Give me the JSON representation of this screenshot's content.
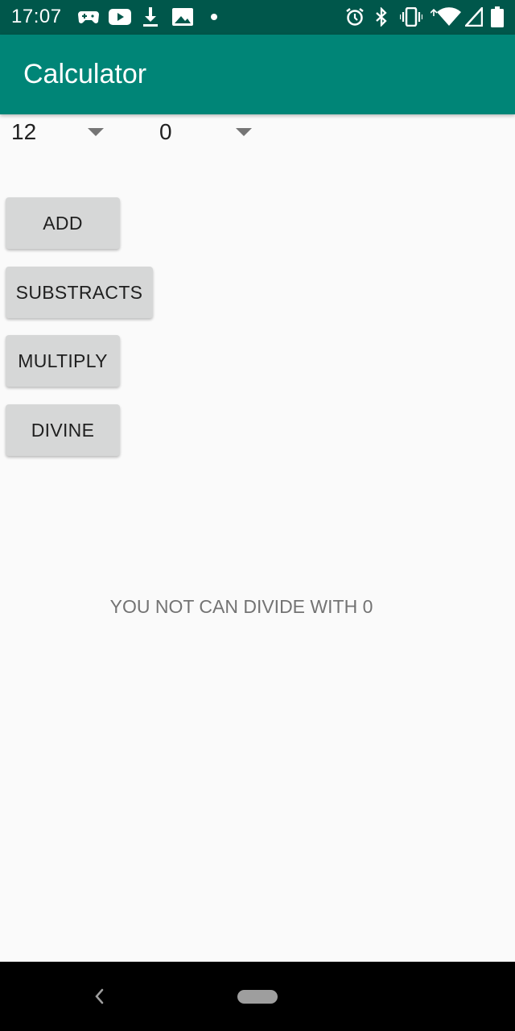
{
  "status_bar": {
    "time": "17:07",
    "left_icons": [
      "gamepad-icon",
      "youtube-icon",
      "download-icon",
      "image-icon",
      "dot-icon"
    ],
    "right_icons": [
      "alarm-icon",
      "bluetooth-icon",
      "vibrate-icon",
      "wifi-icon",
      "signal-icon",
      "battery-icon"
    ]
  },
  "app_bar": {
    "title": "Calculator"
  },
  "spinners": [
    {
      "value": "12"
    },
    {
      "value": "0"
    }
  ],
  "buttons": {
    "add": "ADD",
    "subtract": "SUBSTRACTS",
    "multiply": "MULTIPLY",
    "divide": "DIVINE"
  },
  "result": {
    "text": "YOU NOT CAN DIVIDE WITH 0"
  },
  "colors": {
    "status_bar": "#00574b",
    "app_bar": "#008577",
    "button": "#d6d7d7"
  }
}
